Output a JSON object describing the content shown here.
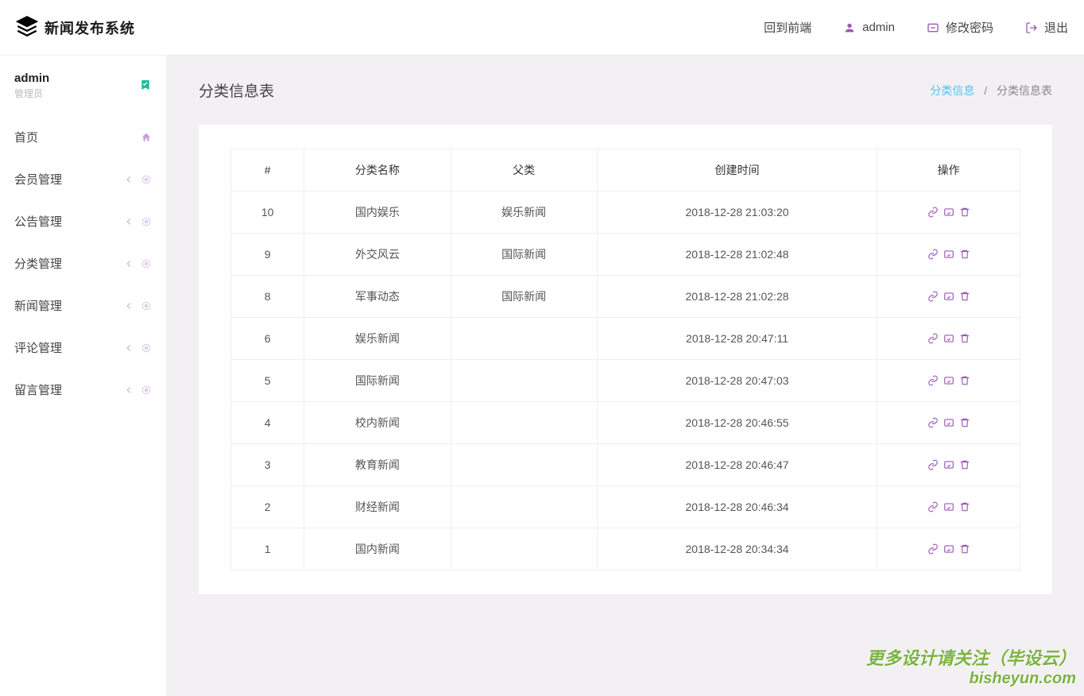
{
  "header": {
    "logo_text": "新闻发布系统",
    "nav": {
      "frontend": "回到前端",
      "user": "admin",
      "password": "修改密码",
      "logout": "退出"
    }
  },
  "sidebar": {
    "user_name": "admin",
    "user_role": "管理员",
    "menu": [
      {
        "label": "首页",
        "type": "home"
      },
      {
        "label": "会员管理",
        "type": "sub"
      },
      {
        "label": "公告管理",
        "type": "sub"
      },
      {
        "label": "分类管理",
        "type": "sub"
      },
      {
        "label": "新闻管理",
        "type": "sub"
      },
      {
        "label": "评论管理",
        "type": "sub"
      },
      {
        "label": "留言管理",
        "type": "sub"
      }
    ]
  },
  "page": {
    "title": "分类信息表",
    "breadcrumb_link": "分类信息",
    "breadcrumb_current": "分类信息表"
  },
  "table": {
    "headers": [
      "#",
      "分类名称",
      "父类",
      "创建时间",
      "操作"
    ],
    "rows": [
      {
        "id": "10",
        "name": "国内娱乐",
        "parent": "娱乐新闻",
        "created": "2018-12-28 21:03:20"
      },
      {
        "id": "9",
        "name": "外交风云",
        "parent": "国际新闻",
        "created": "2018-12-28 21:02:48"
      },
      {
        "id": "8",
        "name": "军事动态",
        "parent": "国际新闻",
        "created": "2018-12-28 21:02:28"
      },
      {
        "id": "6",
        "name": "娱乐新闻",
        "parent": "",
        "created": "2018-12-28 20:47:11"
      },
      {
        "id": "5",
        "name": "国际新闻",
        "parent": "",
        "created": "2018-12-28 20:47:03"
      },
      {
        "id": "4",
        "name": "校内新闻",
        "parent": "",
        "created": "2018-12-28 20:46:55"
      },
      {
        "id": "3",
        "name": "教育新闻",
        "parent": "",
        "created": "2018-12-28 20:46:47"
      },
      {
        "id": "2",
        "name": "财经新闻",
        "parent": "",
        "created": "2018-12-28 20:46:34"
      },
      {
        "id": "1",
        "name": "国内新闻",
        "parent": "",
        "created": "2018-12-28 20:34:34"
      }
    ]
  },
  "watermark": {
    "line1": "更多设计请关注（毕设云）",
    "line2": "bisheyun.com"
  }
}
